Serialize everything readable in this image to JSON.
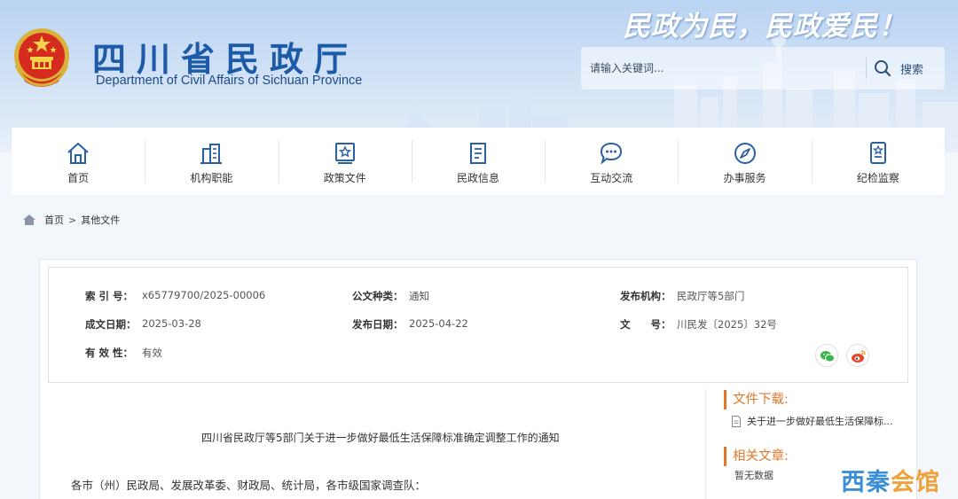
{
  "header": {
    "title_cn": "四川省民政厅",
    "title_en": "Department of Civil Affairs of Sichuan Province",
    "slogan": "民政为民，民政爱民！",
    "logo_icon": "national-emblem-icon"
  },
  "search": {
    "placeholder": "请输入关键词...",
    "button_label": "搜索",
    "icon": "search-icon"
  },
  "nav": {
    "items": [
      {
        "label": "首页",
        "icon": "home-icon"
      },
      {
        "label": "机构职能",
        "icon": "building-icon"
      },
      {
        "label": "政策文件",
        "icon": "document-star-icon"
      },
      {
        "label": "民政信息",
        "icon": "news-icon"
      },
      {
        "label": "互动交流",
        "icon": "chat-icon"
      },
      {
        "label": "办事服务",
        "icon": "compass-icon"
      },
      {
        "label": "纪检监察",
        "icon": "badge-icon"
      }
    ]
  },
  "breadcrumb": {
    "home": "首页",
    "separator": ">",
    "current": "其他文件"
  },
  "meta": {
    "index_no": {
      "key": "索 引 号：",
      "value": "x65779700/2025-00006"
    },
    "doc_type": {
      "key": "公文种类：",
      "value": "通知"
    },
    "issuer": {
      "key": "发布机构：",
      "value": "民政厅等5部门"
    },
    "created_date": {
      "key": "成文日期：",
      "value": "2025-03-28"
    },
    "publish_date": {
      "key": "发布日期：",
      "value": "2025-04-22"
    },
    "doc_no": {
      "key": "文　　号：",
      "value": "川民发〔2025〕32号"
    },
    "validity": {
      "key": "有 效 性：",
      "value": "有效"
    }
  },
  "share": {
    "wechat_icon": "wechat-icon",
    "weibo_icon": "weibo-icon"
  },
  "article": {
    "title": "四川省民政厅等5部门关于进一步做好最低生活保障标准确定调整工作的通知",
    "salutation": "各市（州）民政局、发展改革委、财政局、统计局，各市级国家调查队："
  },
  "sidebar": {
    "download_title": "文件下载:",
    "download_file": "关于进一步做好最低生活保障标...",
    "related_title": "相关文章:",
    "related_empty": "暂无数据"
  },
  "watermark": {
    "part1": "西秦",
    "part2": "会馆"
  },
  "colors": {
    "brand_blue": "#1d5aa8",
    "accent_orange": "#e2772a",
    "header_bg": "#c7dcf5",
    "page_bg": "#f3f6fb"
  }
}
